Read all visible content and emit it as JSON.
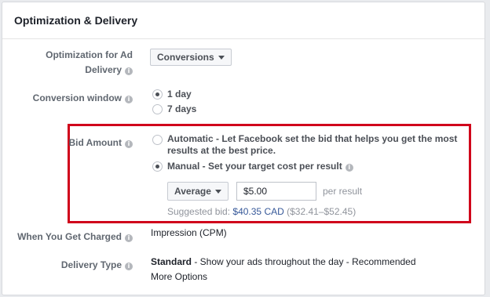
{
  "section": {
    "title": "Optimization & Delivery"
  },
  "optimization": {
    "label_line1": "Optimization for Ad",
    "label_line2": "Delivery",
    "value": "Conversions"
  },
  "conversion_window": {
    "label": "Conversion window",
    "options": [
      {
        "label": "1 day",
        "selected": true
      },
      {
        "label": "7 days",
        "selected": false
      }
    ]
  },
  "bid_amount": {
    "label": "Bid Amount",
    "automatic": {
      "name": "Automatic",
      "desc_line1": " - Let Facebook set the bid that helps you get the most",
      "desc_line2": "results at the best price.",
      "selected": false
    },
    "manual": {
      "name": "Manual",
      "desc": " - Set your target cost per result",
      "selected": true
    },
    "bid_type": "Average",
    "amount": "$5.00",
    "per_result": "per result",
    "suggested_prefix": "Suggested bid: ",
    "suggested_value": "$40.35 CAD",
    "suggested_range": " ($32.41–$52.45)"
  },
  "charged": {
    "label": "When You Get Charged",
    "value": "Impression (CPM)"
  },
  "delivery_type": {
    "label": "Delivery Type",
    "value_bold": "Standard",
    "value_desc": " - Show your ads throughout the day - Recommended",
    "more_options": "More Options"
  },
  "colors": {
    "highlight": "#d0021b",
    "link": "#365899"
  },
  "icons": {
    "info": "info-icon",
    "dropdown": "chevron-down-icon"
  }
}
